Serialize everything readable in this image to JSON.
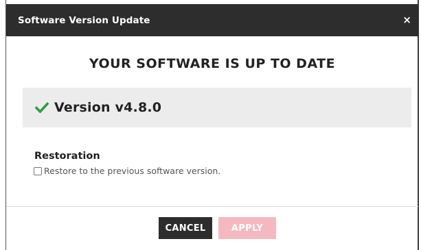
{
  "dialog": {
    "title": "Software Version Update",
    "close_symbol": "×",
    "heading": "YOUR SOFTWARE IS UP TO DATE",
    "version": {
      "icon": "check-icon",
      "label": "Version v4.8.0",
      "icon_color": "#2e9e3e"
    },
    "restoration": {
      "title": "Restoration",
      "checkbox_label": "Restore to the previous software version.",
      "checked": false
    },
    "buttons": {
      "cancel_label": "CANCEL",
      "apply_label": "APPLY"
    },
    "colors": {
      "header_bg": "#2d2d2d",
      "apply_disabled": "#f4b8c1",
      "version_box_bg": "#ececec"
    }
  }
}
